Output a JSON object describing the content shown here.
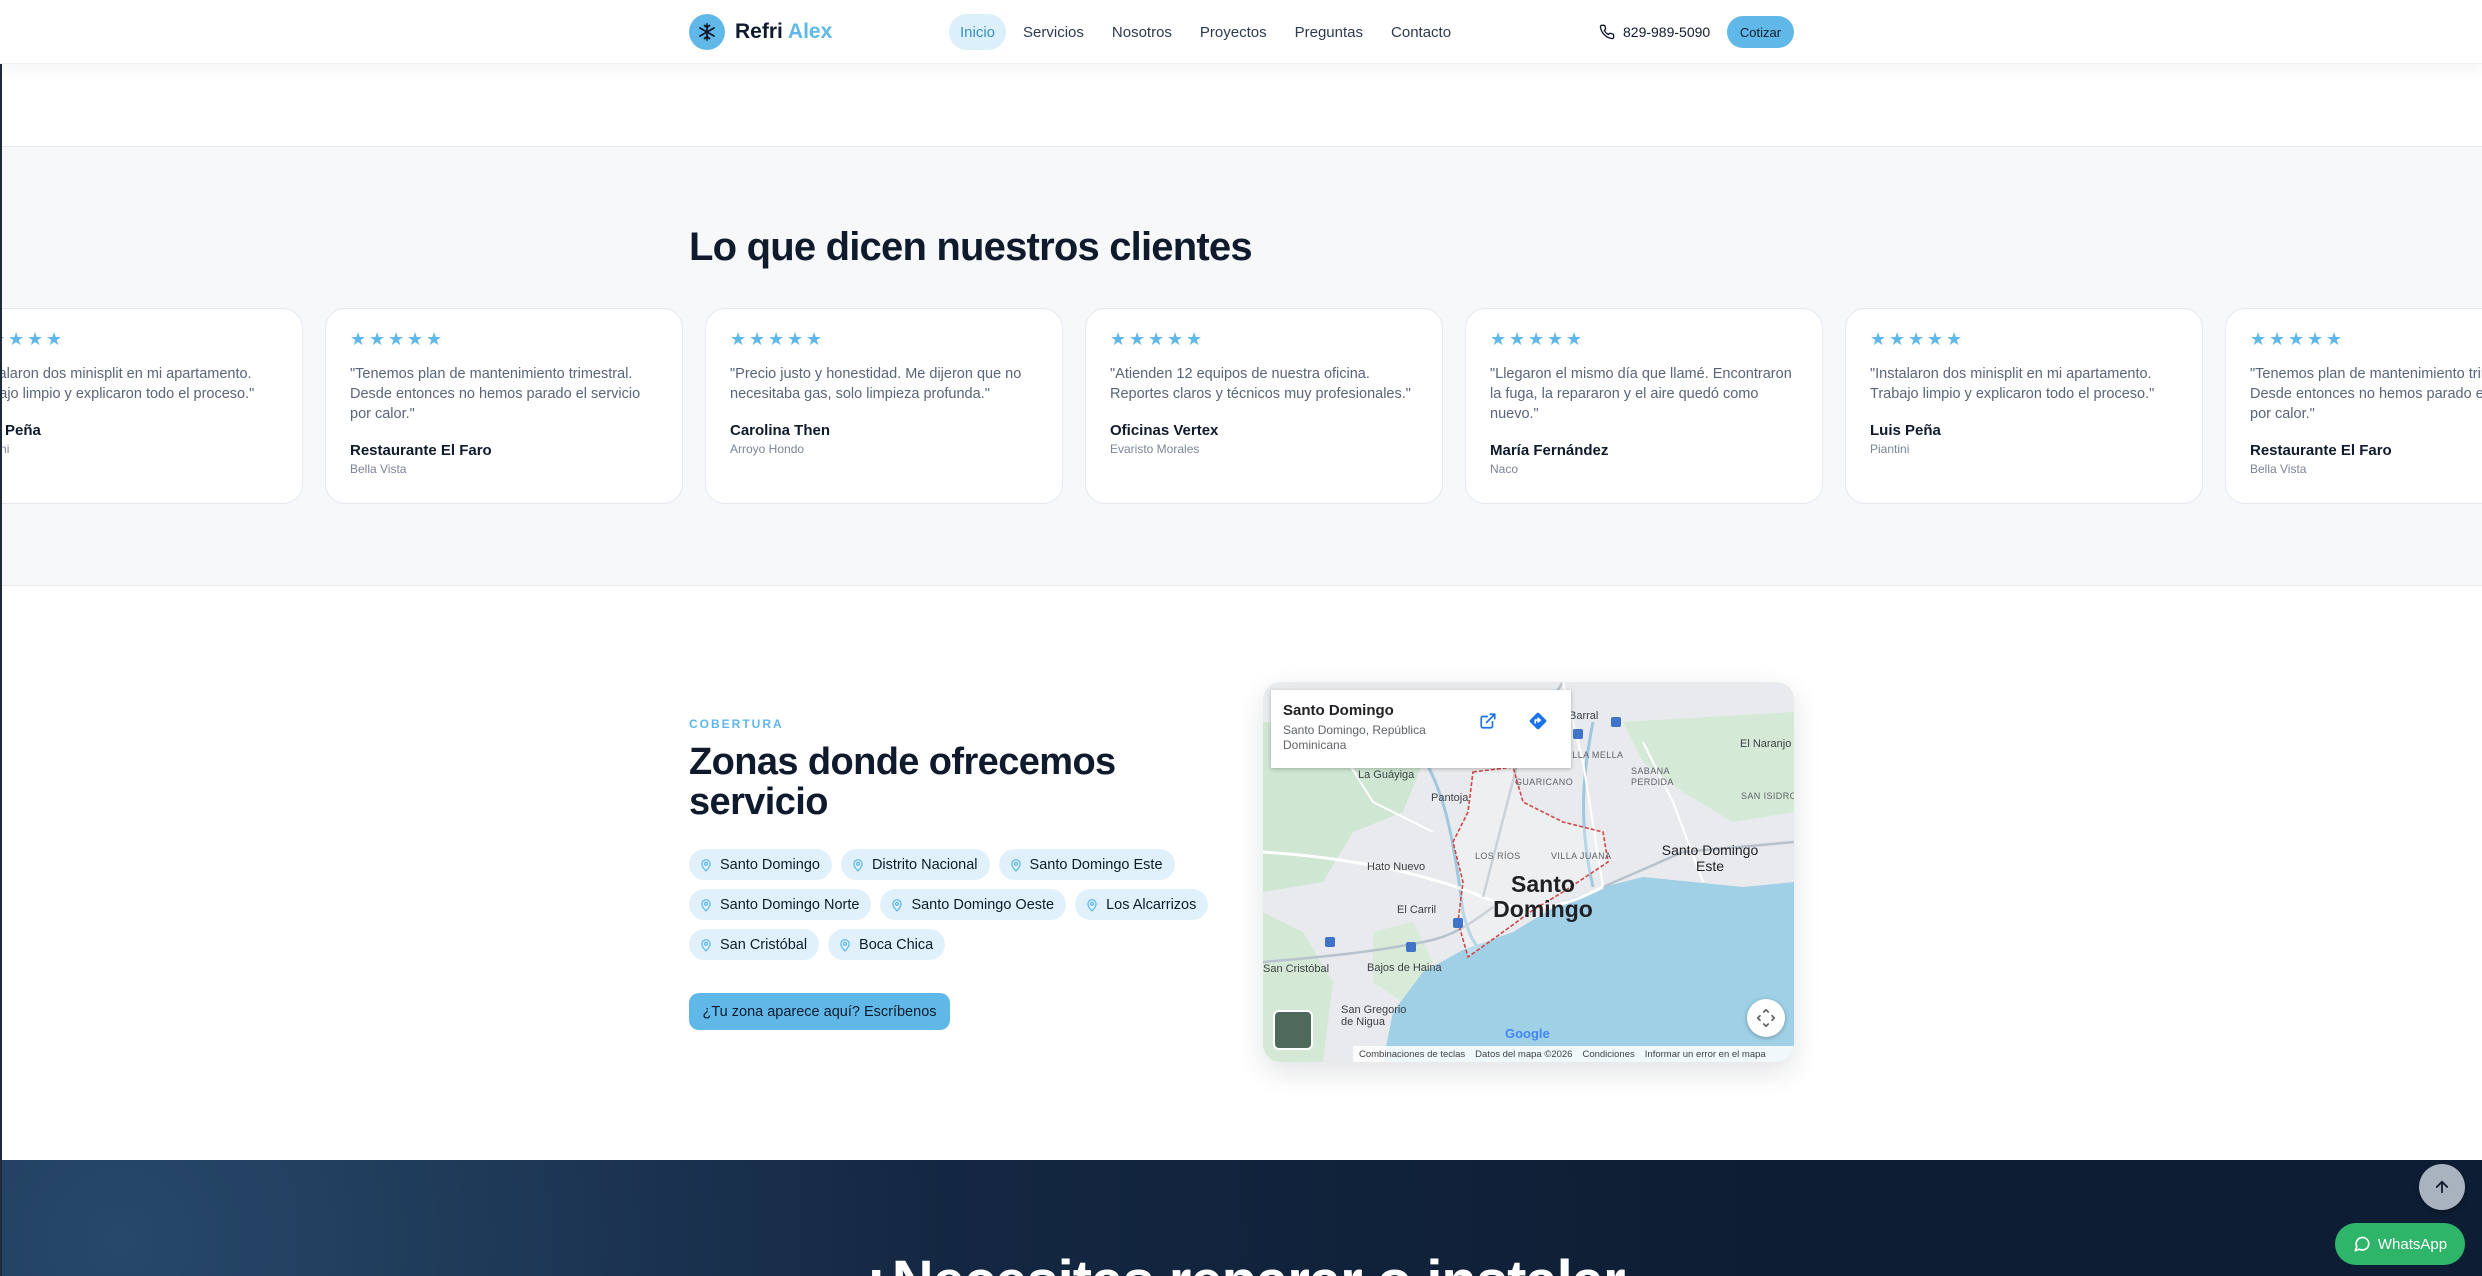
{
  "nav": {
    "brand_main": "Refri",
    "brand_accent": "Alex",
    "links": [
      "Inicio",
      "Servicios",
      "Nosotros",
      "Proyectos",
      "Preguntas",
      "Contacto"
    ],
    "active": "Inicio",
    "phone": "829-989-5090",
    "cta": "Cotizar"
  },
  "testimonials": {
    "title": "Lo que dicen nuestros clientes",
    "cards": [
      {
        "stars": 5,
        "quote": "\"Instalaron dos minisplit en mi apartamento. Trabajo limpio y explicaron todo el proceso.\"",
        "name": "Luis Peña",
        "location": "Piantini"
      },
      {
        "stars": 5,
        "quote": "\"Tenemos plan de mantenimiento trimestral. Desde entonces no hemos parado el servicio por calor.\"",
        "name": "Restaurante El Faro",
        "location": "Bella Vista"
      },
      {
        "stars": 5,
        "quote": "\"Precio justo y honestidad. Me dijeron que no necesitaba gas, solo limpieza profunda.\"",
        "name": "Carolina Then",
        "location": "Arroyo Hondo"
      },
      {
        "stars": 5,
        "quote": "\"Atienden 12 equipos de nuestra oficina. Reportes claros y técnicos muy profesionales.\"",
        "name": "Oficinas Vertex",
        "location": "Evaristo Morales"
      },
      {
        "stars": 5,
        "quote": "\"Llegaron el mismo día que llamé. Encontraron la fuga, la repararon y el aire quedó como nuevo.\"",
        "name": "María Fernández",
        "location": "Naco"
      },
      {
        "stars": 5,
        "quote": "\"Instalaron dos minisplit en mi apartamento. Trabajo limpio y explicaron todo el proceso.\"",
        "name": "Luis Peña",
        "location": "Piantini"
      },
      {
        "stars": 5,
        "quote": "\"Tenemos plan de mantenimiento trimestral. Desde entonces no hemos parado el servicio por calor.\"",
        "name": "Restaurante El Faro",
        "location": "Bella Vista"
      }
    ]
  },
  "coverage": {
    "eyebrow": "COBERTURA",
    "title": "Zonas donde ofrecemos servicio",
    "zones": [
      [
        "Santo Domingo",
        "Distrito Nacional",
        "Santo Domingo Este"
      ],
      [
        "Santo Domingo Norte",
        "Santo Domingo Oeste",
        "Los Alcarrizos"
      ],
      [
        "San Cristóbal",
        "Boca Chica"
      ]
    ],
    "cta": "¿Tu zona aparece aquí? Escríbenos"
  },
  "map": {
    "place": "Santo Domingo",
    "place_sub": "Santo Domingo, República Dominicana",
    "city": "Santo Domingo",
    "labels": [
      "La Guáyiga",
      "Pantoja",
      "GUARICANO",
      "VILLA MELLA",
      "SABANA PERDIDA",
      "El Naranjo",
      "SAN ISIDRO",
      "LOS RÍOS",
      "VILLA JUANA",
      "Santo Domingo Este",
      "Hato Nuevo",
      "El Carril",
      "San Cristóbal",
      "Bajos de Haina",
      "San Gregorio de Nigua",
      "Barral"
    ],
    "google": "Google",
    "footer": [
      "Combinaciones de teclas",
      "Datos del mapa ©2026",
      "Condiciones",
      "Informar un error en el mapa"
    ]
  },
  "cta_banner": {
    "headline": "¿Necesitas reparar o instalar"
  },
  "floating": {
    "whatsapp": "WhatsApp"
  },
  "colors": {
    "accent": "#5fb8e8",
    "chip_bg": "#e1f1fb",
    "dark": "#0f1b2d",
    "whatsapp": "#2fb56a"
  }
}
